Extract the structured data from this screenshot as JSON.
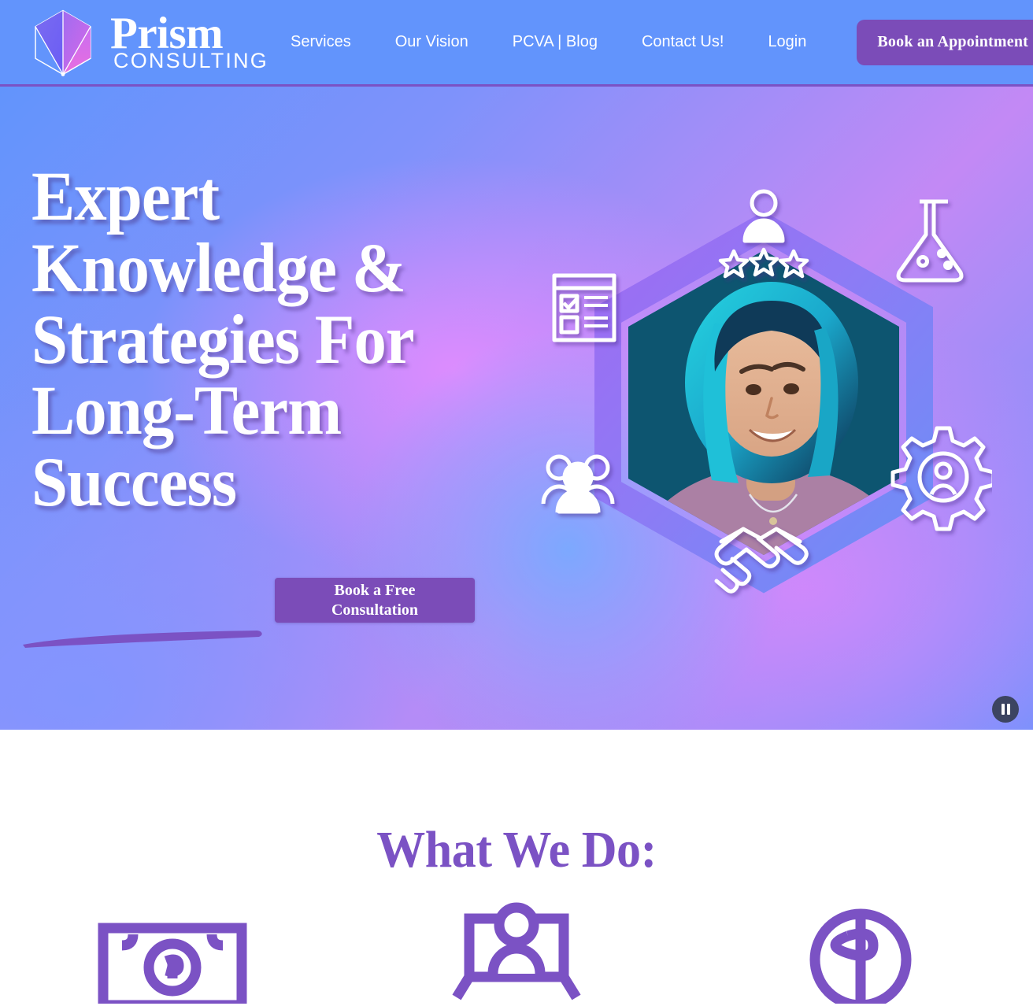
{
  "header": {
    "logo": {
      "mark_icon": "prism-crystal-icon",
      "brand_primary": "Prism",
      "brand_secondary": "Consulting"
    },
    "nav_links": [
      {
        "label": "Services",
        "name": "nav-link-services"
      },
      {
        "label": "Our Vision",
        "name": "nav-link-our-vision"
      },
      {
        "label": "PCVA | Blog",
        "name": "nav-link-pcva-blog"
      },
      {
        "label": "Contact Us!",
        "name": "nav-link-contact-us"
      },
      {
        "label": "Login",
        "name": "nav-link-login"
      }
    ],
    "cta_label": "Book an Appointment",
    "background_color": "#6294fc",
    "border_color": "#7b52c4"
  },
  "hero": {
    "headline_lines": [
      "Expert",
      "Knowledge &",
      "Strategies For",
      "Long-Term",
      "Success"
    ],
    "headline_color": "#ffffff",
    "underline_color": "#7b52c4",
    "cta_line1": "Book a Free",
    "cta_line2": "Consultation",
    "cta_color": "#7b4cb8",
    "slider_control": "pause-button",
    "graphic": {
      "center_photo_alt": "Portrait of smiling woman with teal hair",
      "photo_backdrop_color": "#0d5570",
      "hexagon_ring_colors": [
        "#a06bf0",
        "#6b8ff7"
      ],
      "orbit_icons": [
        {
          "name": "person-rating-stars-icon",
          "position": "top"
        },
        {
          "name": "flask-icon",
          "position": "upper-right"
        },
        {
          "name": "gear-person-icon",
          "position": "lower-right"
        },
        {
          "name": "handshake-icon",
          "position": "bottom"
        },
        {
          "name": "people-group-icon",
          "position": "lower-left"
        },
        {
          "name": "document-checklist-icon",
          "position": "upper-left"
        }
      ]
    }
  },
  "what_we_do": {
    "title": "What We Do:",
    "title_color": "#7b52c4",
    "service_icons": [
      {
        "name": "banknote-icon"
      },
      {
        "name": "presentation-training-icon"
      },
      {
        "name": "dollar-coin-icon"
      }
    ]
  }
}
